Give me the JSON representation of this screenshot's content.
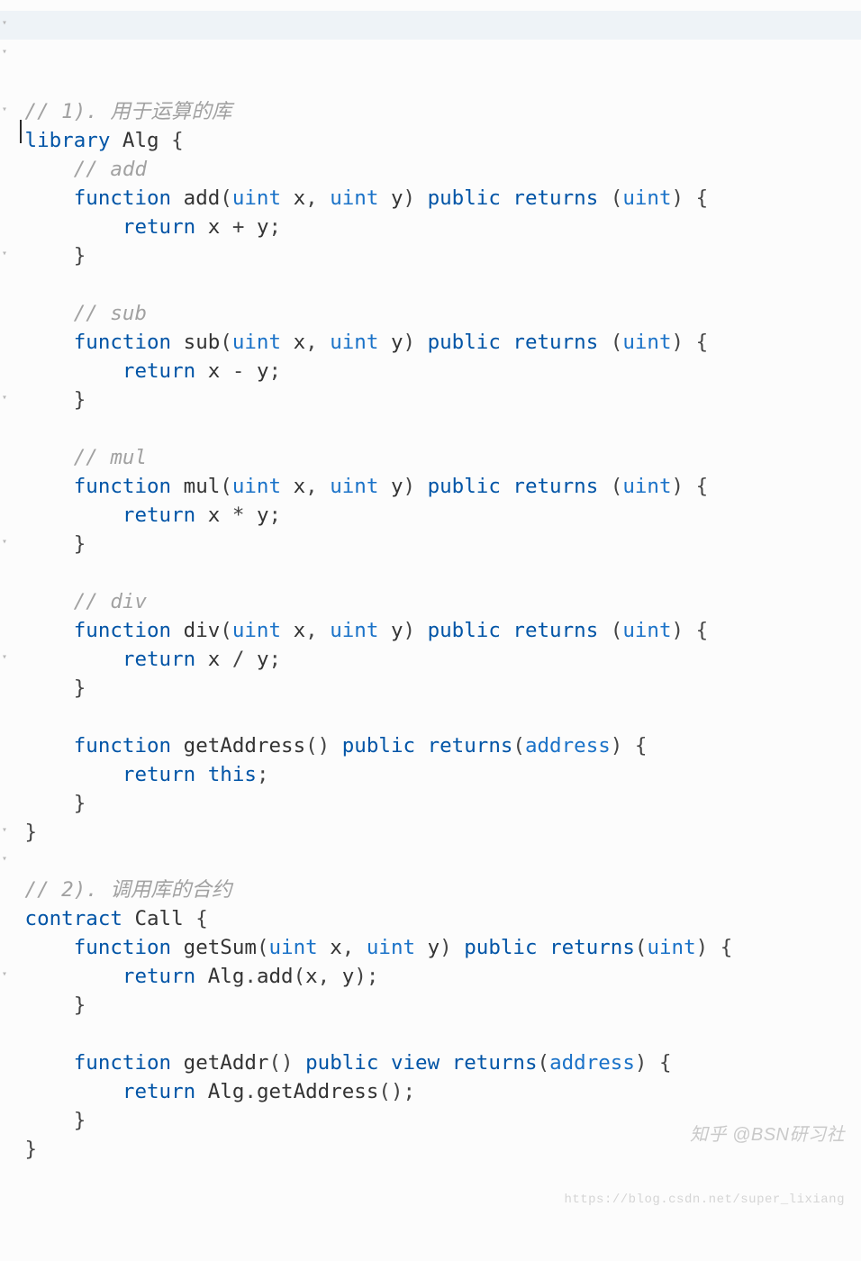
{
  "code": {
    "lines": [
      {
        "indent": 0,
        "tokens": [
          {
            "c": "comment",
            "t": "// 1). 用于运算的库"
          }
        ],
        "fold": true,
        "highlight": true,
        "cursor": true
      },
      {
        "indent": 0,
        "tokens": [
          {
            "c": "keyword",
            "t": "library"
          },
          {
            "c": "punct",
            "t": " "
          },
          {
            "c": "ident",
            "t": "Alg"
          },
          {
            "c": "punct",
            "t": " {"
          }
        ],
        "fold": true
      },
      {
        "indent": 1,
        "tokens": [
          {
            "c": "comment",
            "t": "// add"
          }
        ]
      },
      {
        "indent": 1,
        "tokens": [
          {
            "c": "keyword",
            "t": "function"
          },
          {
            "c": "punct",
            "t": " "
          },
          {
            "c": "ident",
            "t": "add"
          },
          {
            "c": "punct",
            "t": "("
          },
          {
            "c": "type",
            "t": "uint"
          },
          {
            "c": "punct",
            "t": " "
          },
          {
            "c": "ident",
            "t": "x"
          },
          {
            "c": "punct",
            "t": ", "
          },
          {
            "c": "type",
            "t": "uint"
          },
          {
            "c": "punct",
            "t": " "
          },
          {
            "c": "ident",
            "t": "y"
          },
          {
            "c": "punct",
            "t": ") "
          },
          {
            "c": "keyword",
            "t": "public"
          },
          {
            "c": "punct",
            "t": " "
          },
          {
            "c": "keyword",
            "t": "returns"
          },
          {
            "c": "punct",
            "t": " ("
          },
          {
            "c": "type",
            "t": "uint"
          },
          {
            "c": "punct",
            "t": ") {"
          }
        ],
        "fold": true
      },
      {
        "indent": 2,
        "tokens": [
          {
            "c": "keyword",
            "t": "return"
          },
          {
            "c": "punct",
            "t": " "
          },
          {
            "c": "ident",
            "t": "x"
          },
          {
            "c": "punct",
            "t": " "
          },
          {
            "c": "op",
            "t": "+"
          },
          {
            "c": "punct",
            "t": " "
          },
          {
            "c": "ident",
            "t": "y"
          },
          {
            "c": "punct",
            "t": ";"
          }
        ]
      },
      {
        "indent": 1,
        "tokens": [
          {
            "c": "punct",
            "t": "}"
          }
        ]
      },
      {
        "indent": 1,
        "tokens": []
      },
      {
        "indent": 1,
        "tokens": [
          {
            "c": "comment",
            "t": "// sub"
          }
        ]
      },
      {
        "indent": 1,
        "tokens": [
          {
            "c": "keyword",
            "t": "function"
          },
          {
            "c": "punct",
            "t": " "
          },
          {
            "c": "ident",
            "t": "sub"
          },
          {
            "c": "punct",
            "t": "("
          },
          {
            "c": "type",
            "t": "uint"
          },
          {
            "c": "punct",
            "t": " "
          },
          {
            "c": "ident",
            "t": "x"
          },
          {
            "c": "punct",
            "t": ", "
          },
          {
            "c": "type",
            "t": "uint"
          },
          {
            "c": "punct",
            "t": " "
          },
          {
            "c": "ident",
            "t": "y"
          },
          {
            "c": "punct",
            "t": ") "
          },
          {
            "c": "keyword",
            "t": "public"
          },
          {
            "c": "punct",
            "t": " "
          },
          {
            "c": "keyword",
            "t": "returns"
          },
          {
            "c": "punct",
            "t": " ("
          },
          {
            "c": "type",
            "t": "uint"
          },
          {
            "c": "punct",
            "t": ") {"
          }
        ],
        "fold": true
      },
      {
        "indent": 2,
        "tokens": [
          {
            "c": "keyword",
            "t": "return"
          },
          {
            "c": "punct",
            "t": " "
          },
          {
            "c": "ident",
            "t": "x"
          },
          {
            "c": "punct",
            "t": " "
          },
          {
            "c": "op",
            "t": "-"
          },
          {
            "c": "punct",
            "t": " "
          },
          {
            "c": "ident",
            "t": "y"
          },
          {
            "c": "punct",
            "t": ";"
          }
        ]
      },
      {
        "indent": 1,
        "tokens": [
          {
            "c": "punct",
            "t": "}"
          }
        ]
      },
      {
        "indent": 1,
        "tokens": []
      },
      {
        "indent": 1,
        "tokens": [
          {
            "c": "comment",
            "t": "// mul"
          }
        ]
      },
      {
        "indent": 1,
        "tokens": [
          {
            "c": "keyword",
            "t": "function"
          },
          {
            "c": "punct",
            "t": " "
          },
          {
            "c": "ident",
            "t": "mul"
          },
          {
            "c": "punct",
            "t": "("
          },
          {
            "c": "type",
            "t": "uint"
          },
          {
            "c": "punct",
            "t": " "
          },
          {
            "c": "ident",
            "t": "x"
          },
          {
            "c": "punct",
            "t": ", "
          },
          {
            "c": "type",
            "t": "uint"
          },
          {
            "c": "punct",
            "t": " "
          },
          {
            "c": "ident",
            "t": "y"
          },
          {
            "c": "punct",
            "t": ") "
          },
          {
            "c": "keyword",
            "t": "public"
          },
          {
            "c": "punct",
            "t": " "
          },
          {
            "c": "keyword",
            "t": "returns"
          },
          {
            "c": "punct",
            "t": " ("
          },
          {
            "c": "type",
            "t": "uint"
          },
          {
            "c": "punct",
            "t": ") {"
          }
        ],
        "fold": true
      },
      {
        "indent": 2,
        "tokens": [
          {
            "c": "keyword",
            "t": "return"
          },
          {
            "c": "punct",
            "t": " "
          },
          {
            "c": "ident",
            "t": "x"
          },
          {
            "c": "punct",
            "t": " "
          },
          {
            "c": "op",
            "t": "*"
          },
          {
            "c": "punct",
            "t": " "
          },
          {
            "c": "ident",
            "t": "y"
          },
          {
            "c": "punct",
            "t": ";"
          }
        ]
      },
      {
        "indent": 1,
        "tokens": [
          {
            "c": "punct",
            "t": "}"
          }
        ]
      },
      {
        "indent": 1,
        "tokens": []
      },
      {
        "indent": 1,
        "tokens": [
          {
            "c": "comment",
            "t": "// div"
          }
        ]
      },
      {
        "indent": 1,
        "tokens": [
          {
            "c": "keyword",
            "t": "function"
          },
          {
            "c": "punct",
            "t": " "
          },
          {
            "c": "ident",
            "t": "div"
          },
          {
            "c": "punct",
            "t": "("
          },
          {
            "c": "type",
            "t": "uint"
          },
          {
            "c": "punct",
            "t": " "
          },
          {
            "c": "ident",
            "t": "x"
          },
          {
            "c": "punct",
            "t": ", "
          },
          {
            "c": "type",
            "t": "uint"
          },
          {
            "c": "punct",
            "t": " "
          },
          {
            "c": "ident",
            "t": "y"
          },
          {
            "c": "punct",
            "t": ") "
          },
          {
            "c": "keyword",
            "t": "public"
          },
          {
            "c": "punct",
            "t": " "
          },
          {
            "c": "keyword",
            "t": "returns"
          },
          {
            "c": "punct",
            "t": " ("
          },
          {
            "c": "type",
            "t": "uint"
          },
          {
            "c": "punct",
            "t": ") {"
          }
        ],
        "fold": true
      },
      {
        "indent": 2,
        "tokens": [
          {
            "c": "keyword",
            "t": "return"
          },
          {
            "c": "punct",
            "t": " "
          },
          {
            "c": "ident",
            "t": "x"
          },
          {
            "c": "punct",
            "t": " "
          },
          {
            "c": "op",
            "t": "/"
          },
          {
            "c": "punct",
            "t": " "
          },
          {
            "c": "ident",
            "t": "y"
          },
          {
            "c": "punct",
            "t": ";"
          }
        ]
      },
      {
        "indent": 1,
        "tokens": [
          {
            "c": "punct",
            "t": "}"
          }
        ]
      },
      {
        "indent": 1,
        "tokens": []
      },
      {
        "indent": 1,
        "tokens": [
          {
            "c": "keyword",
            "t": "function"
          },
          {
            "c": "punct",
            "t": " "
          },
          {
            "c": "ident",
            "t": "getAddress"
          },
          {
            "c": "punct",
            "t": "() "
          },
          {
            "c": "keyword",
            "t": "public"
          },
          {
            "c": "punct",
            "t": " "
          },
          {
            "c": "keyword",
            "t": "returns"
          },
          {
            "c": "punct",
            "t": "("
          },
          {
            "c": "type",
            "t": "address"
          },
          {
            "c": "punct",
            "t": ") {"
          }
        ],
        "fold": true
      },
      {
        "indent": 2,
        "tokens": [
          {
            "c": "keyword",
            "t": "return"
          },
          {
            "c": "punct",
            "t": " "
          },
          {
            "c": "keyword",
            "t": "this"
          },
          {
            "c": "punct",
            "t": ";"
          }
        ]
      },
      {
        "indent": 1,
        "tokens": [
          {
            "c": "punct",
            "t": "}"
          }
        ]
      },
      {
        "indent": 0,
        "tokens": [
          {
            "c": "punct",
            "t": "}"
          }
        ]
      },
      {
        "indent": 0,
        "tokens": []
      },
      {
        "indent": 0,
        "tokens": [
          {
            "c": "comment",
            "t": "// 2). 调用库的合约"
          }
        ]
      },
      {
        "indent": 0,
        "tokens": [
          {
            "c": "keyword",
            "t": "contract"
          },
          {
            "c": "punct",
            "t": " "
          },
          {
            "c": "ident",
            "t": "Call"
          },
          {
            "c": "punct",
            "t": " {"
          }
        ],
        "fold": true
      },
      {
        "indent": 1,
        "tokens": [
          {
            "c": "keyword",
            "t": "function"
          },
          {
            "c": "punct",
            "t": " "
          },
          {
            "c": "ident",
            "t": "getSum"
          },
          {
            "c": "punct",
            "t": "("
          },
          {
            "c": "type",
            "t": "uint"
          },
          {
            "c": "punct",
            "t": " "
          },
          {
            "c": "ident",
            "t": "x"
          },
          {
            "c": "punct",
            "t": ", "
          },
          {
            "c": "type",
            "t": "uint"
          },
          {
            "c": "punct",
            "t": " "
          },
          {
            "c": "ident",
            "t": "y"
          },
          {
            "c": "punct",
            "t": ") "
          },
          {
            "c": "keyword",
            "t": "public"
          },
          {
            "c": "punct",
            "t": " "
          },
          {
            "c": "keyword",
            "t": "returns"
          },
          {
            "c": "punct",
            "t": "("
          },
          {
            "c": "type",
            "t": "uint"
          },
          {
            "c": "punct",
            "t": ") {"
          }
        ],
        "fold": true
      },
      {
        "indent": 2,
        "tokens": [
          {
            "c": "keyword",
            "t": "return"
          },
          {
            "c": "punct",
            "t": " "
          },
          {
            "c": "ident",
            "t": "Alg"
          },
          {
            "c": "punct",
            "t": "."
          },
          {
            "c": "ident",
            "t": "add"
          },
          {
            "c": "punct",
            "t": "("
          },
          {
            "c": "ident",
            "t": "x"
          },
          {
            "c": "punct",
            "t": ", "
          },
          {
            "c": "ident",
            "t": "y"
          },
          {
            "c": "punct",
            "t": ");"
          }
        ]
      },
      {
        "indent": 1,
        "tokens": [
          {
            "c": "punct",
            "t": "}"
          }
        ]
      },
      {
        "indent": 1,
        "tokens": []
      },
      {
        "indent": 1,
        "tokens": [
          {
            "c": "keyword",
            "t": "function"
          },
          {
            "c": "punct",
            "t": " "
          },
          {
            "c": "ident",
            "t": "getAddr"
          },
          {
            "c": "punct",
            "t": "() "
          },
          {
            "c": "keyword",
            "t": "public"
          },
          {
            "c": "punct",
            "t": " "
          },
          {
            "c": "keyword",
            "t": "view"
          },
          {
            "c": "punct",
            "t": " "
          },
          {
            "c": "keyword",
            "t": "returns"
          },
          {
            "c": "punct",
            "t": "("
          },
          {
            "c": "type",
            "t": "address"
          },
          {
            "c": "punct",
            "t": ") {"
          }
        ],
        "fold": true
      },
      {
        "indent": 2,
        "tokens": [
          {
            "c": "keyword",
            "t": "return"
          },
          {
            "c": "punct",
            "t": " "
          },
          {
            "c": "ident",
            "t": "Alg"
          },
          {
            "c": "punct",
            "t": "."
          },
          {
            "c": "ident",
            "t": "getAddress"
          },
          {
            "c": "punct",
            "t": "();"
          }
        ]
      },
      {
        "indent": 1,
        "tokens": [
          {
            "c": "punct",
            "t": "}"
          }
        ]
      },
      {
        "indent": 0,
        "tokens": [
          {
            "c": "punct",
            "t": "}"
          }
        ]
      }
    ]
  },
  "watermark": {
    "line1": "知乎 @BSN研习社",
    "line2": "https://blog.csdn.net/super_lixiang"
  },
  "indent_unit": "    "
}
